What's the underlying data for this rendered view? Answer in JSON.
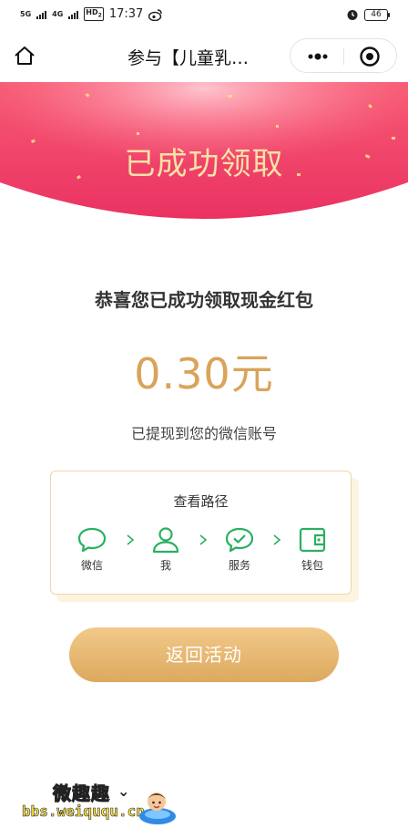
{
  "status_bar": {
    "net1": "5G",
    "net2": "4G",
    "hd": "HD",
    "hd_sub": "2",
    "time": "17:37",
    "battery": "46"
  },
  "nav": {
    "title": "参与【儿童乳…"
  },
  "banner": {
    "title": "已成功领取"
  },
  "result": {
    "headline": "恭喜您已成功领取现金红包",
    "amount": "0.30元",
    "subtext": "已提现到您的微信账号"
  },
  "path_card": {
    "title": "查看路径",
    "steps": [
      {
        "label": "微信",
        "icon": "chat-bubble-icon"
      },
      {
        "label": "我",
        "icon": "person-icon"
      },
      {
        "label": "服务",
        "icon": "check-bubble-icon"
      },
      {
        "label": "钱包",
        "icon": "wallet-icon"
      }
    ]
  },
  "return_button": {
    "label": "返回活动"
  },
  "watermark": {
    "brand": "微趣趣",
    "url": "bbs.weiququ.cn"
  },
  "colors": {
    "banner_red": "#f0456a",
    "gold_text": "#f8e2a6",
    "amount_gold": "#d9a45a",
    "icon_green": "#27b15e",
    "button_gold": "#e4b46c"
  }
}
